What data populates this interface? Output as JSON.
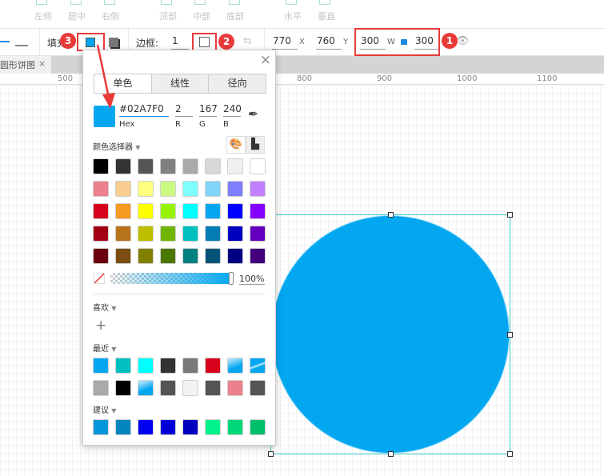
{
  "align_toolbar": {
    "items": [
      "左侧",
      "居中",
      "右侧",
      "顶部",
      "中部",
      "底部",
      "水平",
      "垂直"
    ]
  },
  "style_toolbar": {
    "fill_label": "填充",
    "border_label": "边框:",
    "border_width": "1",
    "x": "770",
    "x_label": "X",
    "y": "760",
    "y_label": "Y",
    "w": "300",
    "w_label": "W",
    "h": "300"
  },
  "annotations": {
    "badge1": "1",
    "badge2": "2",
    "badge3": "3"
  },
  "document_tab": {
    "title": "圆形饼图",
    "close": "×"
  },
  "ruler": {
    "ticks": [
      "500",
      "800",
      "900",
      "1000",
      "1100"
    ]
  },
  "color_panel": {
    "close": "×",
    "tabs": [
      "单色",
      "线性",
      "径向"
    ],
    "hex": "#02A7F0",
    "hex_label": "Hex",
    "r": "2",
    "r_label": "R",
    "g": "167",
    "g_label": "G",
    "b": "240",
    "b_label": "B",
    "picker_label": "颜色选择器",
    "palette": [
      [
        "#000000",
        "#333333",
        "#555555",
        "#808080",
        "#aaaaaa",
        "#d8d8d8",
        "#f0f0f0",
        "#ffffff"
      ],
      [
        "#ec808d",
        "#facd91",
        "#ffff80",
        "#caf982",
        "#80ffff",
        "#81d3f8",
        "#8080ff",
        "#c280ff"
      ],
      [
        "#d9001b",
        "#f59a23",
        "#ffff00",
        "#95f204",
        "#00ffff",
        "#02a7f0",
        "#0000ff",
        "#8400ff"
      ],
      [
        "#a30014",
        "#b8741a",
        "#bfbf00",
        "#70b603",
        "#00bfbf",
        "#027db4",
        "#0000bf",
        "#6300bf"
      ],
      [
        "#6d000e",
        "#7b4d12",
        "#808000",
        "#4b7902",
        "#008080",
        "#015478",
        "#000080",
        "#42007f"
      ]
    ],
    "opacity": "100%",
    "favorites_label": "喜欢",
    "add": "+",
    "recent_label": "最近",
    "recent": [
      [
        "#02a7f0",
        "#00bfbf",
        "#00ffff",
        "#333333",
        "#797979",
        "#d9001b",
        "grad1",
        "grad2"
      ],
      [
        "#aaaaaa",
        "#000000",
        "grad1",
        "#555555",
        "#f2f2f2",
        "#555555",
        "#ec808d",
        "#555555"
      ]
    ],
    "suggest_label": "建议",
    "suggest": [
      "#0096d9",
      "#0085bf",
      "#0000f2",
      "#0000d9",
      "#0000bf",
      "#00f28a",
      "#00d979",
      "#00bf6b"
    ]
  },
  "shape": {
    "fill": "#02a7f0"
  }
}
